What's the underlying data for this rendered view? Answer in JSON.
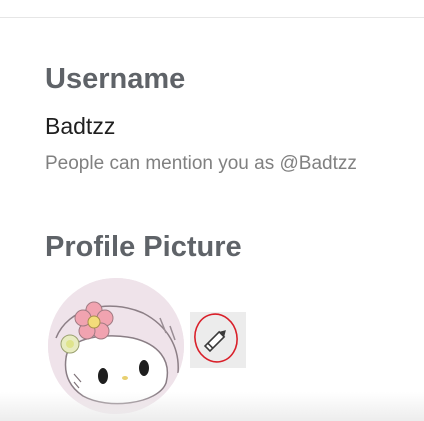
{
  "username_section": {
    "title": "Username",
    "value": "Badtzz",
    "mention_text": "People can mention you as @Badtzz"
  },
  "profile_picture_section": {
    "title": "Profile Picture",
    "avatar_icon": "my-melody-avatar",
    "edit_icon": "pencil-icon",
    "colors": {
      "avatar_background": "#efe3ea",
      "annotation_circle": "#d9202a"
    }
  }
}
